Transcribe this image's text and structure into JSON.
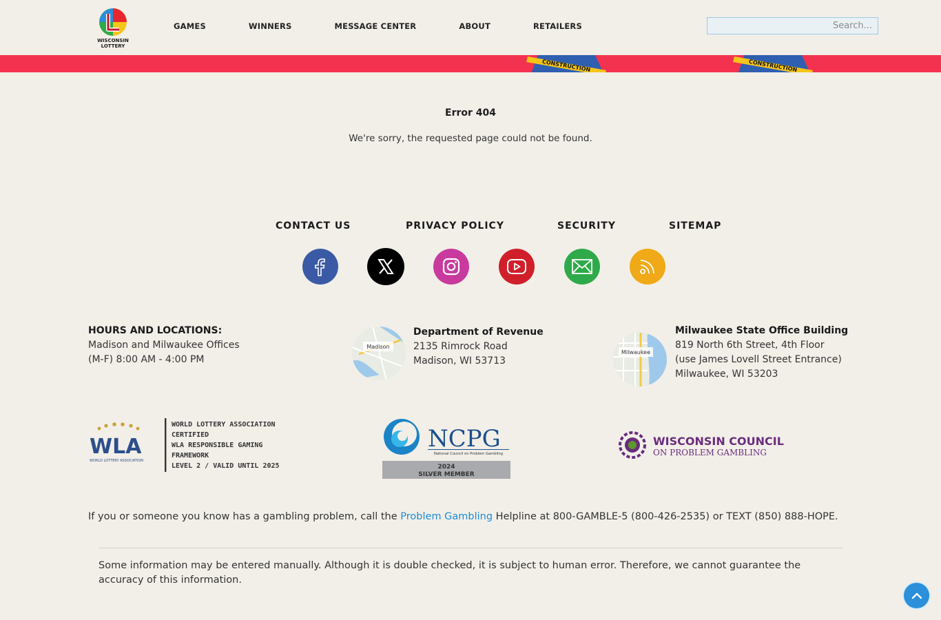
{
  "header": {
    "logo_alt": "Wisconsin Lottery",
    "logo_text_1": "WISCONSIN",
    "logo_text_2": "LOTTERY",
    "nav": [
      "GAMES",
      "WINNERS",
      "MESSAGE CENTER",
      "ABOUT",
      "RETAILERS"
    ],
    "search_placeholder": "Search..."
  },
  "hero": {
    "tape_text": "CONSTRUCTION"
  },
  "error": {
    "title": "Error 404",
    "message": "We're sorry, the requested page could not be found."
  },
  "footer_links": [
    "CONTACT US",
    "PRIVACY POLICY",
    "SECURITY",
    "SITEMAP"
  ],
  "social": [
    {
      "name": "facebook",
      "color": "#3b5aa6"
    },
    {
      "name": "x",
      "color": "#000000"
    },
    {
      "name": "instagram",
      "color": "#c83a9e"
    },
    {
      "name": "youtube",
      "color": "#d01f2a"
    },
    {
      "name": "email",
      "color": "#2faa4a"
    },
    {
      "name": "rss",
      "color": "#f0a917"
    }
  ],
  "locations": {
    "hours_title": "HOURS AND LOCATIONS:",
    "hours_line1": "Madison and Milwaukee Offices",
    "hours_line2": "(M-F) 8:00 AM - 4:00 PM",
    "madison": {
      "map_label": "Madison",
      "title": "Department of Revenue",
      "line1": "2135 Rimrock Road",
      "line2": "Madison, WI 53713"
    },
    "milwaukee": {
      "map_label": "Milwaukee",
      "title": "Milwaukee State Office Building",
      "line1": "819 North 6th Street, 4th Floor",
      "line2": "(use James Lovell Street Entrance)",
      "line3": "Milwaukee, WI 53203"
    }
  },
  "partners": {
    "wla": {
      "mark": "WLA",
      "mark_sub": "WORLD LOTTERY ASSOCIATION",
      "lines": [
        "WORLD LOTTERY ASSOCIATION",
        "CERTIFIED",
        "WLA RESPONSIBLE GAMING",
        "FRAMEWORK",
        "LEVEL 2 / VALID UNTIL 2025"
      ]
    },
    "ncpg": {
      "mark": "NCPG",
      "sub": "National Council on Problem Gambling",
      "year": "2024",
      "member": "SILVER MEMBER"
    },
    "wcpg": {
      "line1": "WISCONSIN COUNCIL",
      "line2": "ON PROBLEM GAMBLING"
    }
  },
  "gambling": {
    "before": "If you or someone you know has a gambling problem, call the ",
    "link": "Problem Gambling",
    "after": " Helpline at 800-GAMBLE-5 (800-426-2535) or TEXT (850) 888-HOPE."
  },
  "disclaimer": "Some information may be entered manually. Although it is double checked, it is subject to human error. Therefore, we cannot guarantee the accuracy of this information."
}
